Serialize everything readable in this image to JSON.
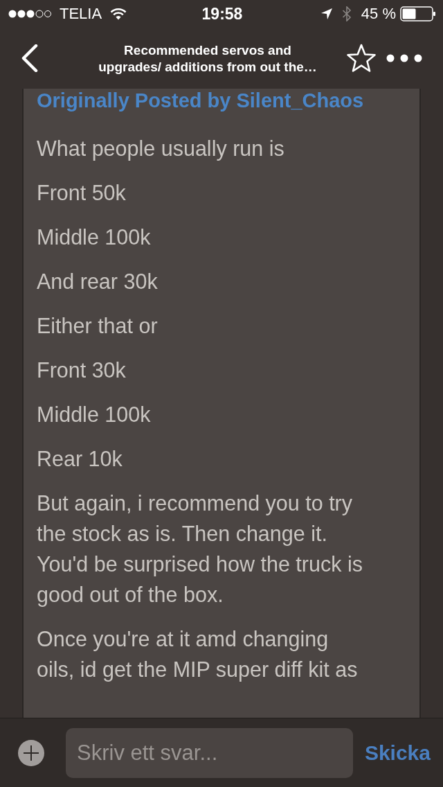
{
  "status_bar": {
    "carrier": "TELIA",
    "time": "19:58",
    "battery": "45 %"
  },
  "nav_bar": {
    "title": "Recommended servos and upgrades/ additions from out the…"
  },
  "quote": {
    "attribution": "Originally Posted by Silent_Chaos",
    "groups": [
      [
        "What people usually run is",
        "Front 50k",
        "Middle 100k",
        "And rear 30k"
      ],
      [
        "Either that or",
        "Front 30k",
        "Middle 100k",
        "Rear 10k"
      ],
      [
        "But again, i recommend you to try the stock as is. Then change it. You'd be surprised how the truck is good out of the box.",
        "Once you're at it amd changing oils, id get the MIP super diff kit as"
      ]
    ]
  },
  "composer": {
    "placeholder": "Skriv ett svar...",
    "send_label": "Skicka"
  }
}
